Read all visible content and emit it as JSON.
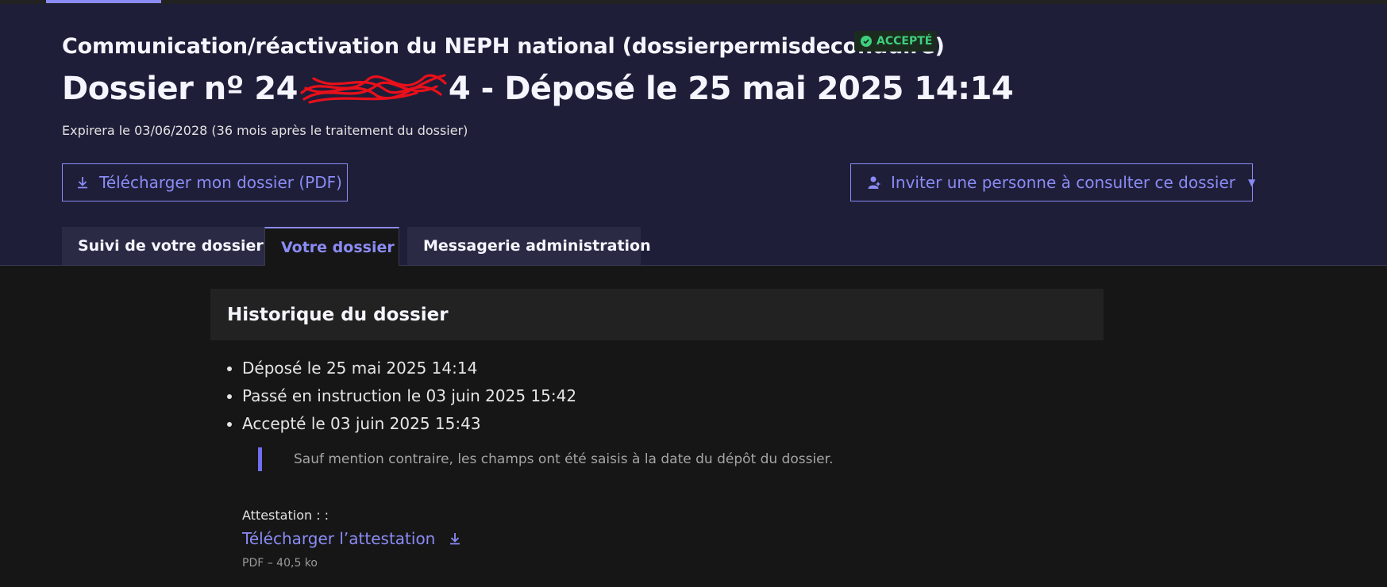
{
  "header": {
    "procedure_title": "Communication/réactivation du NEPH national (dossierpermisdeconduire)",
    "status_badge": "ACCEPTÉ",
    "dossier_prefix": "Dossier nº 24",
    "dossier_suffix": "4 - Déposé le 25 mai 2025 14:14",
    "expiration": "Expirera le 03/06/2028 (36 mois après le traitement du dossier)"
  },
  "actions": {
    "download_label": "Télécharger mon dossier (PDF)",
    "invite_label": "Inviter une personne à consulter ce dossier"
  },
  "tabs": [
    {
      "label": "Suivi de votre dossier",
      "active": false
    },
    {
      "label": "Votre dossier",
      "active": true
    },
    {
      "label": "Messagerie administration",
      "active": false
    }
  ],
  "history": {
    "title": "Historique du dossier",
    "items": [
      "Déposé le 25 mai 2025 14:14",
      "Passé en instruction le 03 juin 2025 15:42",
      "Accepté le 03 juin 2025 15:43"
    ],
    "notice": "Sauf mention contraire, les champs ont été saisis à la date du dépôt du dossier."
  },
  "attestation": {
    "label": "Attestation : :",
    "link_label": "Télécharger l’attestation",
    "file_info": "PDF – 40,5 ko"
  },
  "colors": {
    "accent": "#8b8bf5",
    "header_bg": "#1e1e39",
    "success": "#3ecf7d",
    "redaction": "#e8101a"
  },
  "icons": {
    "status": "check-circle-icon",
    "download": "download-icon",
    "invite": "user-add-icon",
    "dropdown": "caret-down-icon"
  }
}
